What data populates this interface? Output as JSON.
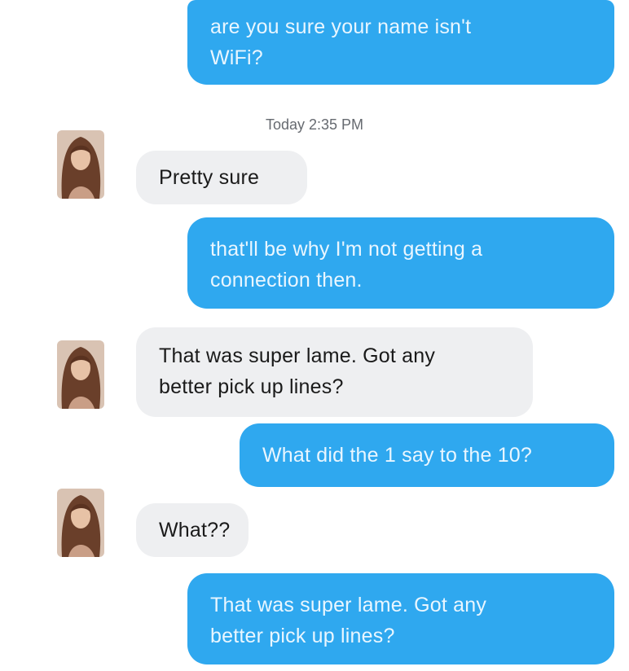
{
  "conversation": {
    "timestamp": "Today 2:35 PM",
    "messages": [
      {
        "sender": "me",
        "lines": [
          "are you sure your name isn't",
          "WiFi?"
        ]
      },
      {
        "sender": "contact",
        "lines": [
          "Pretty sure"
        ]
      },
      {
        "sender": "me",
        "lines": [
          "that'll be why I'm not getting a",
          "connection then."
        ]
      },
      {
        "sender": "contact",
        "lines": [
          "That was super lame. Got any",
          "better pick up lines?"
        ]
      },
      {
        "sender": "me",
        "lines": [
          "What did the 1 say to the 10?"
        ]
      },
      {
        "sender": "contact",
        "lines": [
          "What??"
        ]
      },
      {
        "sender": "me",
        "lines": [
          "That was super lame. Got any",
          "better pick up lines?"
        ]
      }
    ]
  },
  "colors": {
    "outgoing_bubble": "#2fa8ef",
    "outgoing_text": "#e9f6ff",
    "incoming_bubble": "#eeeff1",
    "incoming_text": "#1a1a1a",
    "timestamp_text": "#666a70"
  },
  "icons": {
    "contact_avatar": "profile-photo-icon"
  }
}
